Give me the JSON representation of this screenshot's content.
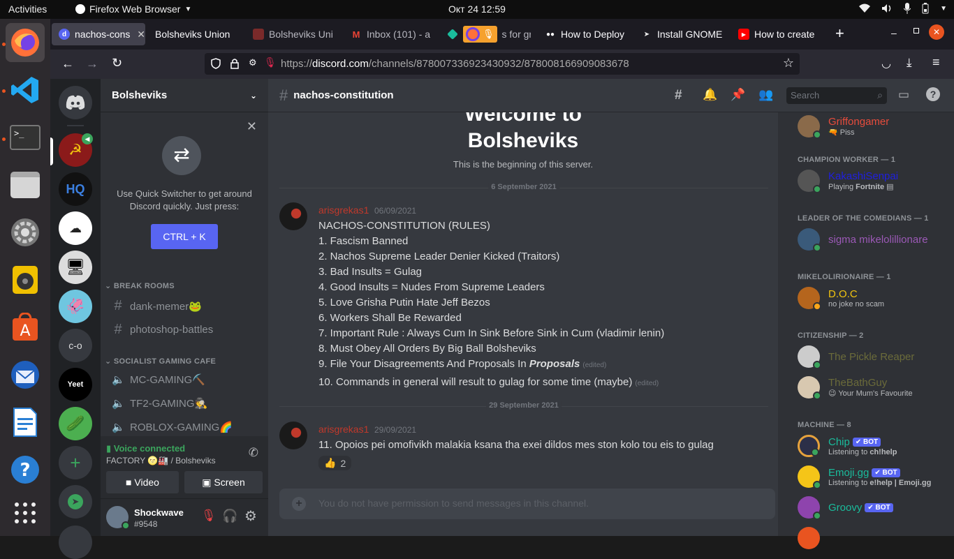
{
  "topbar": {
    "activities": "Activities",
    "app_name": "Firefox Web Browser",
    "clock": "Окт 24  12:59"
  },
  "tabs": [
    {
      "label": "nachos-cons"
    },
    {
      "label": "Bolsheviks Union"
    },
    {
      "label": "Bolsheviks Uni"
    },
    {
      "label": "Inbox (101) - a"
    },
    {
      "label": "s for gr"
    },
    {
      "label": "How to Deploy"
    },
    {
      "label": "Install GNOME"
    },
    {
      "label": "How to create"
    }
  ],
  "navbar": {
    "url_prefix": "https://",
    "url_domain": "discord.com",
    "url_path": "/channels/878007336923430932/878008166909083678"
  },
  "server": {
    "name": "Bolsheviks",
    "guild_initials": "c-o",
    "guild_text": "Yeet"
  },
  "quick_switcher": {
    "text": "Use Quick Switcher to get around Discord quickly. Just press:",
    "button": "CTRL + K"
  },
  "categories": [
    {
      "name": "BREAK ROOMS",
      "channels": [
        {
          "name": "dank-memer🐸",
          "type": "text"
        },
        {
          "name": "photoshop-battles",
          "type": "text"
        }
      ]
    },
    {
      "name": "SOCIALIST GAMING CAFE",
      "channels": [
        {
          "name": "MC-GAMING⛏️",
          "type": "voice"
        },
        {
          "name": "TF2-GAMING🕵️",
          "type": "voice"
        },
        {
          "name": "ROBLOX-GAMING🌈",
          "type": "voice"
        }
      ]
    }
  ],
  "voice": {
    "status": "Voice connected",
    "location": "FACTORY 🌝🏭 / Bolsheviks",
    "video": "Video",
    "screen": "Screen"
  },
  "user": {
    "name": "Shockwave",
    "tag": "#9548"
  },
  "channel": {
    "name": "nachos-constitution",
    "search_placeholder": "Search"
  },
  "welcome": {
    "title_top": "Welcome to",
    "title_bottom": "Bolsheviks",
    "subtitle": "This is the beginning of this server."
  },
  "messages": [
    {
      "date_divider": "6 September 2021",
      "author": "arisgrekas1",
      "timestamp": "06/09/2021",
      "lines": [
        "NACHOS-CONSTITUTION (RULES)",
        "1. Fascism Banned",
        "2. Nachos Supreme Leader Denier Kicked (Traitors)",
        "3. Bad Insults = Gulag",
        "4. Good Insults = Nudes From Supreme Leaders",
        "5. Love Grisha Putin Hate Jeff Bezos",
        "6. Workers Shall Be Rewarded",
        "7. Important Rule : Always Cum In Sink Before Sink in Cum (vladimir lenin)",
        "8. Must Obey All Orders By Big Ball Bolsheviks"
      ],
      "line9_prefix": "9. File Your Disagreements And Proposals In ",
      "line9_bold": "Proposals",
      "line10": "10. Commands in general will result to gulag for some time (maybe)",
      "edited": "(edited)"
    },
    {
      "date_divider": "29 September 2021",
      "author": "arisgrekas1",
      "timestamp": "29/09/2021",
      "text": "11. Opoios pei omofivikh malakia ksana tha exei dildos mes ston kolo tou eis to gulag",
      "reaction_emoji": "👍",
      "reaction_count": "2"
    }
  ],
  "composer": {
    "placeholder": "You do not have permission to send messages in this channel."
  },
  "members": {
    "top": {
      "name": "Griffongamer",
      "status": "🔫 Piss",
      "color": "#e74c3c"
    },
    "groups": [
      {
        "title": "CHAMPION WORKER — 1",
        "members": [
          {
            "name": "KakashiSenpai",
            "status_prefix": "Playing ",
            "status_bold": "Fortnite",
            "color": "#1f1fe0"
          }
        ]
      },
      {
        "title": "LEADER OF THE COMEDIANS — 1",
        "members": [
          {
            "name": "sigma mikelolillionare",
            "color": "#9b59b6"
          }
        ]
      },
      {
        "title": "MIKELOLIRIONAIRE — 1",
        "members": [
          {
            "name": "D.O.C",
            "status": "no joke no scam",
            "color": "#f1c40f"
          }
        ]
      },
      {
        "title": "CITIZENSHIP — 2",
        "members": [
          {
            "name": "The Pickle Reaper",
            "color": "#6b6b3a"
          },
          {
            "name": "TheBathGuy",
            "status": "😉 Your Mum's Favourite",
            "color": "#6b6b3a"
          }
        ]
      },
      {
        "title": "MACHINE — 8",
        "members": [
          {
            "name": "Chip",
            "status_prefix": "Listening to ",
            "status_bold": "ch!help",
            "color": "#1abc9c"
          },
          {
            "name": "Emoji.gg",
            "status_prefix": "Listening to ",
            "status_bold": "e!help | Emoji.gg",
            "color": "#1abc9c"
          },
          {
            "name": "Groovy",
            "color": "#1abc9c"
          }
        ]
      }
    ],
    "bot_label": "✔ BOT"
  },
  "colors": {
    "blurple": "#5865f2",
    "author": "#c0392b",
    "online": "#3ba55d"
  }
}
